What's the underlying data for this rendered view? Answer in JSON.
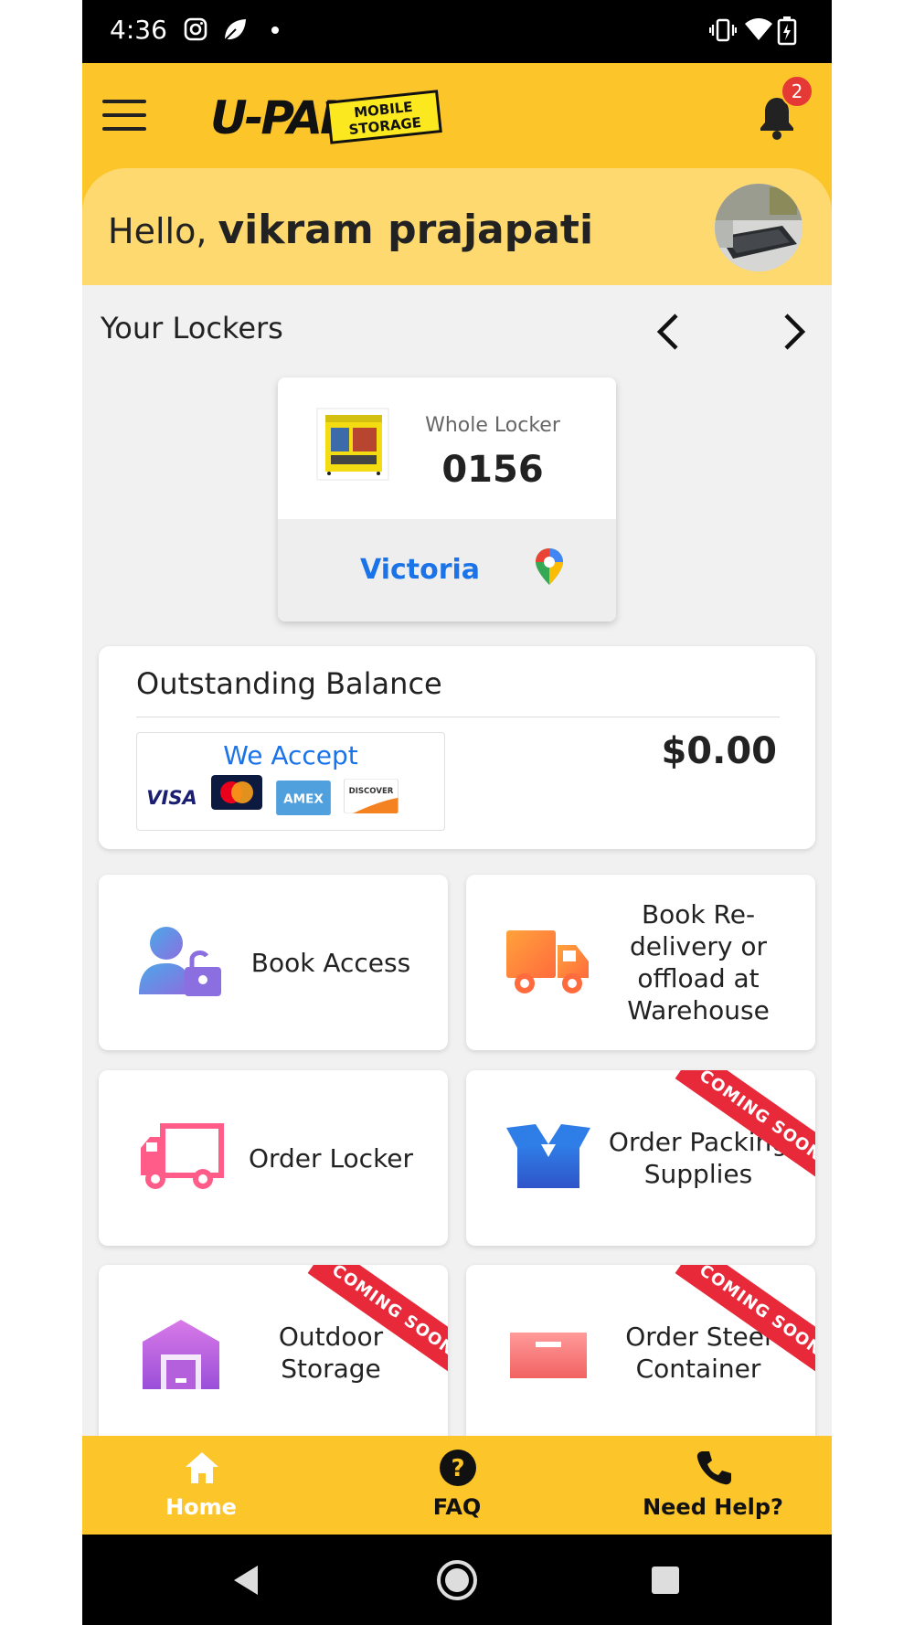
{
  "status_bar": {
    "time": "4:36"
  },
  "header": {
    "logo_text": "U-PAK",
    "logo_subtext_1": "MOBILE",
    "logo_subtext_2": "STORAGE",
    "notification_count": "2"
  },
  "greeting": {
    "hello": "Hello,",
    "name": "vikram prajapati"
  },
  "lockers": {
    "title": "Your Lockers",
    "card": {
      "type": "Whole Locker",
      "number": "0156",
      "location": "Victoria"
    }
  },
  "balance": {
    "title": "Outstanding Balance",
    "accept_label": "We Accept",
    "amount": "$0.00",
    "cards": [
      "VISA",
      "MasterCard",
      "AMEX",
      "DISCOVER"
    ]
  },
  "actions": [
    {
      "label": "Book Access",
      "icon": "user-lock-icon",
      "coming_soon": false
    },
    {
      "label": "Book Re-delivery or offload at Warehouse",
      "icon": "delivery-truck-icon",
      "coming_soon": false
    },
    {
      "label": "Order Locker",
      "icon": "truck-icon",
      "coming_soon": false
    },
    {
      "label": "Order Packing Supplies",
      "icon": "open-box-icon",
      "coming_soon": true
    },
    {
      "label": "Outdoor Storage",
      "icon": "warehouse-icon",
      "coming_soon": true
    },
    {
      "label": "Order Steel Container",
      "icon": "container-icon",
      "coming_soon": true
    }
  ],
  "ribbon_text": "COMING SOON",
  "bottom_nav": {
    "home": "Home",
    "faq": "FAQ",
    "help": "Need Help?"
  },
  "colors": {
    "brand_yellow": "#fcc52a",
    "greeting_bg": "#fdd96f",
    "link_blue": "#1a73e8",
    "ribbon_red": "#e8293a"
  }
}
